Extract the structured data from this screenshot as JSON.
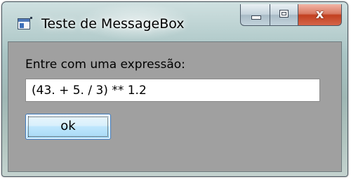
{
  "window": {
    "title": "Teste de MessageBox",
    "icon": "app-window-icon",
    "controls": {
      "minimize_icon": "minimize-icon",
      "maximize_icon": "maximize-icon",
      "close_icon": "close-icon",
      "close_glyph": "x"
    }
  },
  "form": {
    "prompt_label": "Entre com uma expressão:",
    "expression_value": "(43. + 5. / 3) ** 1.2",
    "ok_label": "ok"
  },
  "colors": {
    "client_background": "#a0a0a0",
    "close_button": "#c2401f",
    "ok_button_border": "#3b7bbf"
  }
}
